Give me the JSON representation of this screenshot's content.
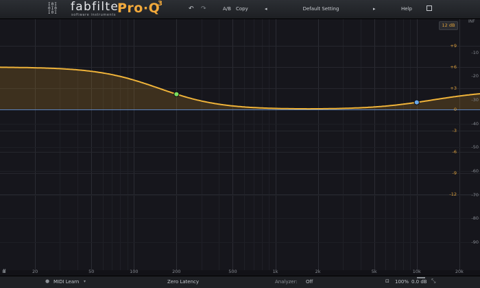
{
  "header": {
    "brand": "fabfilter",
    "brand_sub": "software instruments",
    "product": "Pro·Q",
    "product_sup": "3",
    "undo_icon": "↶",
    "redo_icon": "↷",
    "ab": "A/B",
    "copy": "Copy",
    "prev_icon": "◂",
    "preset": "Default Setting",
    "next_icon": "▸",
    "help": "Help"
  },
  "graph": {
    "range": "12 dB",
    "inf": "INF",
    "gain_labels": [
      "+9",
      "+6",
      "+3",
      "0",
      "-3",
      "-6",
      "-9",
      "-12"
    ],
    "spectrum_labels": [
      "-10",
      "-20",
      "-30",
      "-40",
      "-50",
      "-60",
      "-70",
      "-80",
      "-90"
    ],
    "freq_labels": [
      "20",
      "50",
      "100",
      "200",
      "500",
      "1k",
      "2k",
      "5k",
      "10k",
      "20k"
    ],
    "bands": [
      {
        "type": "low-shelf",
        "freq_hz": 200,
        "color": "#7be05e"
      },
      {
        "type": "high-shelf",
        "freq_hz": 10000,
        "color": "#6aa8e8"
      }
    ],
    "curve_color": "#f0b43a",
    "zero_line_color": "#5b86c4",
    "analyzer_icon": "ılıl"
  },
  "footer": {
    "midi_dot": "●",
    "midi_learn": "MIDI Learn",
    "midi_arrow": "▾",
    "latency": "Zero Latency",
    "analyzer_label": "Analyzer:",
    "analyzer_value": "Off",
    "bypass_icon": "⊡",
    "zoom": "100%",
    "output_gain": "0.0 dB",
    "resize_icon": "⤡"
  }
}
